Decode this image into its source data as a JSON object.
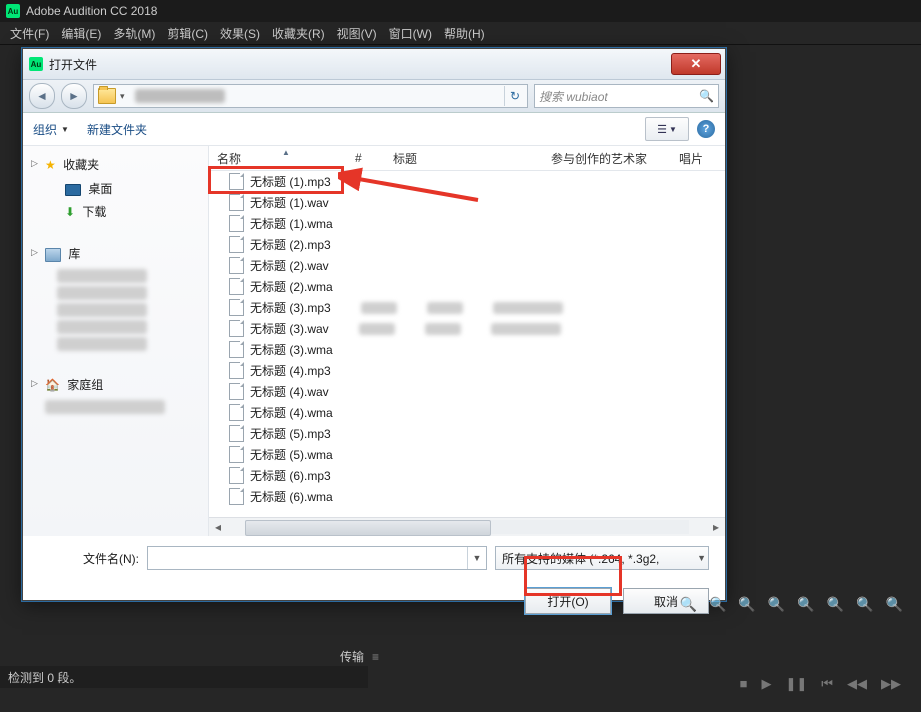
{
  "app": {
    "title": "Adobe Audition CC 2018"
  },
  "menu": [
    "文件(F)",
    "编辑(E)",
    "多轨(M)",
    "剪辑(C)",
    "效果(S)",
    "收藏夹(R)",
    "视图(V)",
    "窗口(W)",
    "帮助(H)"
  ],
  "dialog": {
    "title": "打开文件",
    "search_placeholder": "搜索 wubiaot",
    "organize": "组织",
    "new_folder": "新建文件夹",
    "columns": {
      "name": "名称",
      "num": "#",
      "title": "标题",
      "artist": "参与创作的艺术家",
      "album": "唱片"
    },
    "sidebar": {
      "fav": "收藏夹",
      "desktop": "桌面",
      "downloads": "下载",
      "lib": "库",
      "home": "家庭组"
    },
    "files": [
      "无标题 (1).mp3",
      "无标题 (1).wav",
      "无标题 (1).wma",
      "无标题 (2).mp3",
      "无标题 (2).wav",
      "无标题 (2).wma",
      "无标题 (3).mp3",
      "无标题 (3).wav",
      "无标题 (3).wma",
      "无标题 (4).mp3",
      "无标题 (4).wav",
      "无标题 (4).wma",
      "无标题 (5).mp3",
      "无标题 (5).wma",
      "无标题 (6).mp3",
      "无标题 (6).wma"
    ],
    "filename_label": "文件名(N):",
    "filter": "所有支持的媒体 (*.264, *.3g2,",
    "open": "打开(O)",
    "cancel": "取消"
  },
  "status": "检测到 0 段。",
  "panel": "传输"
}
